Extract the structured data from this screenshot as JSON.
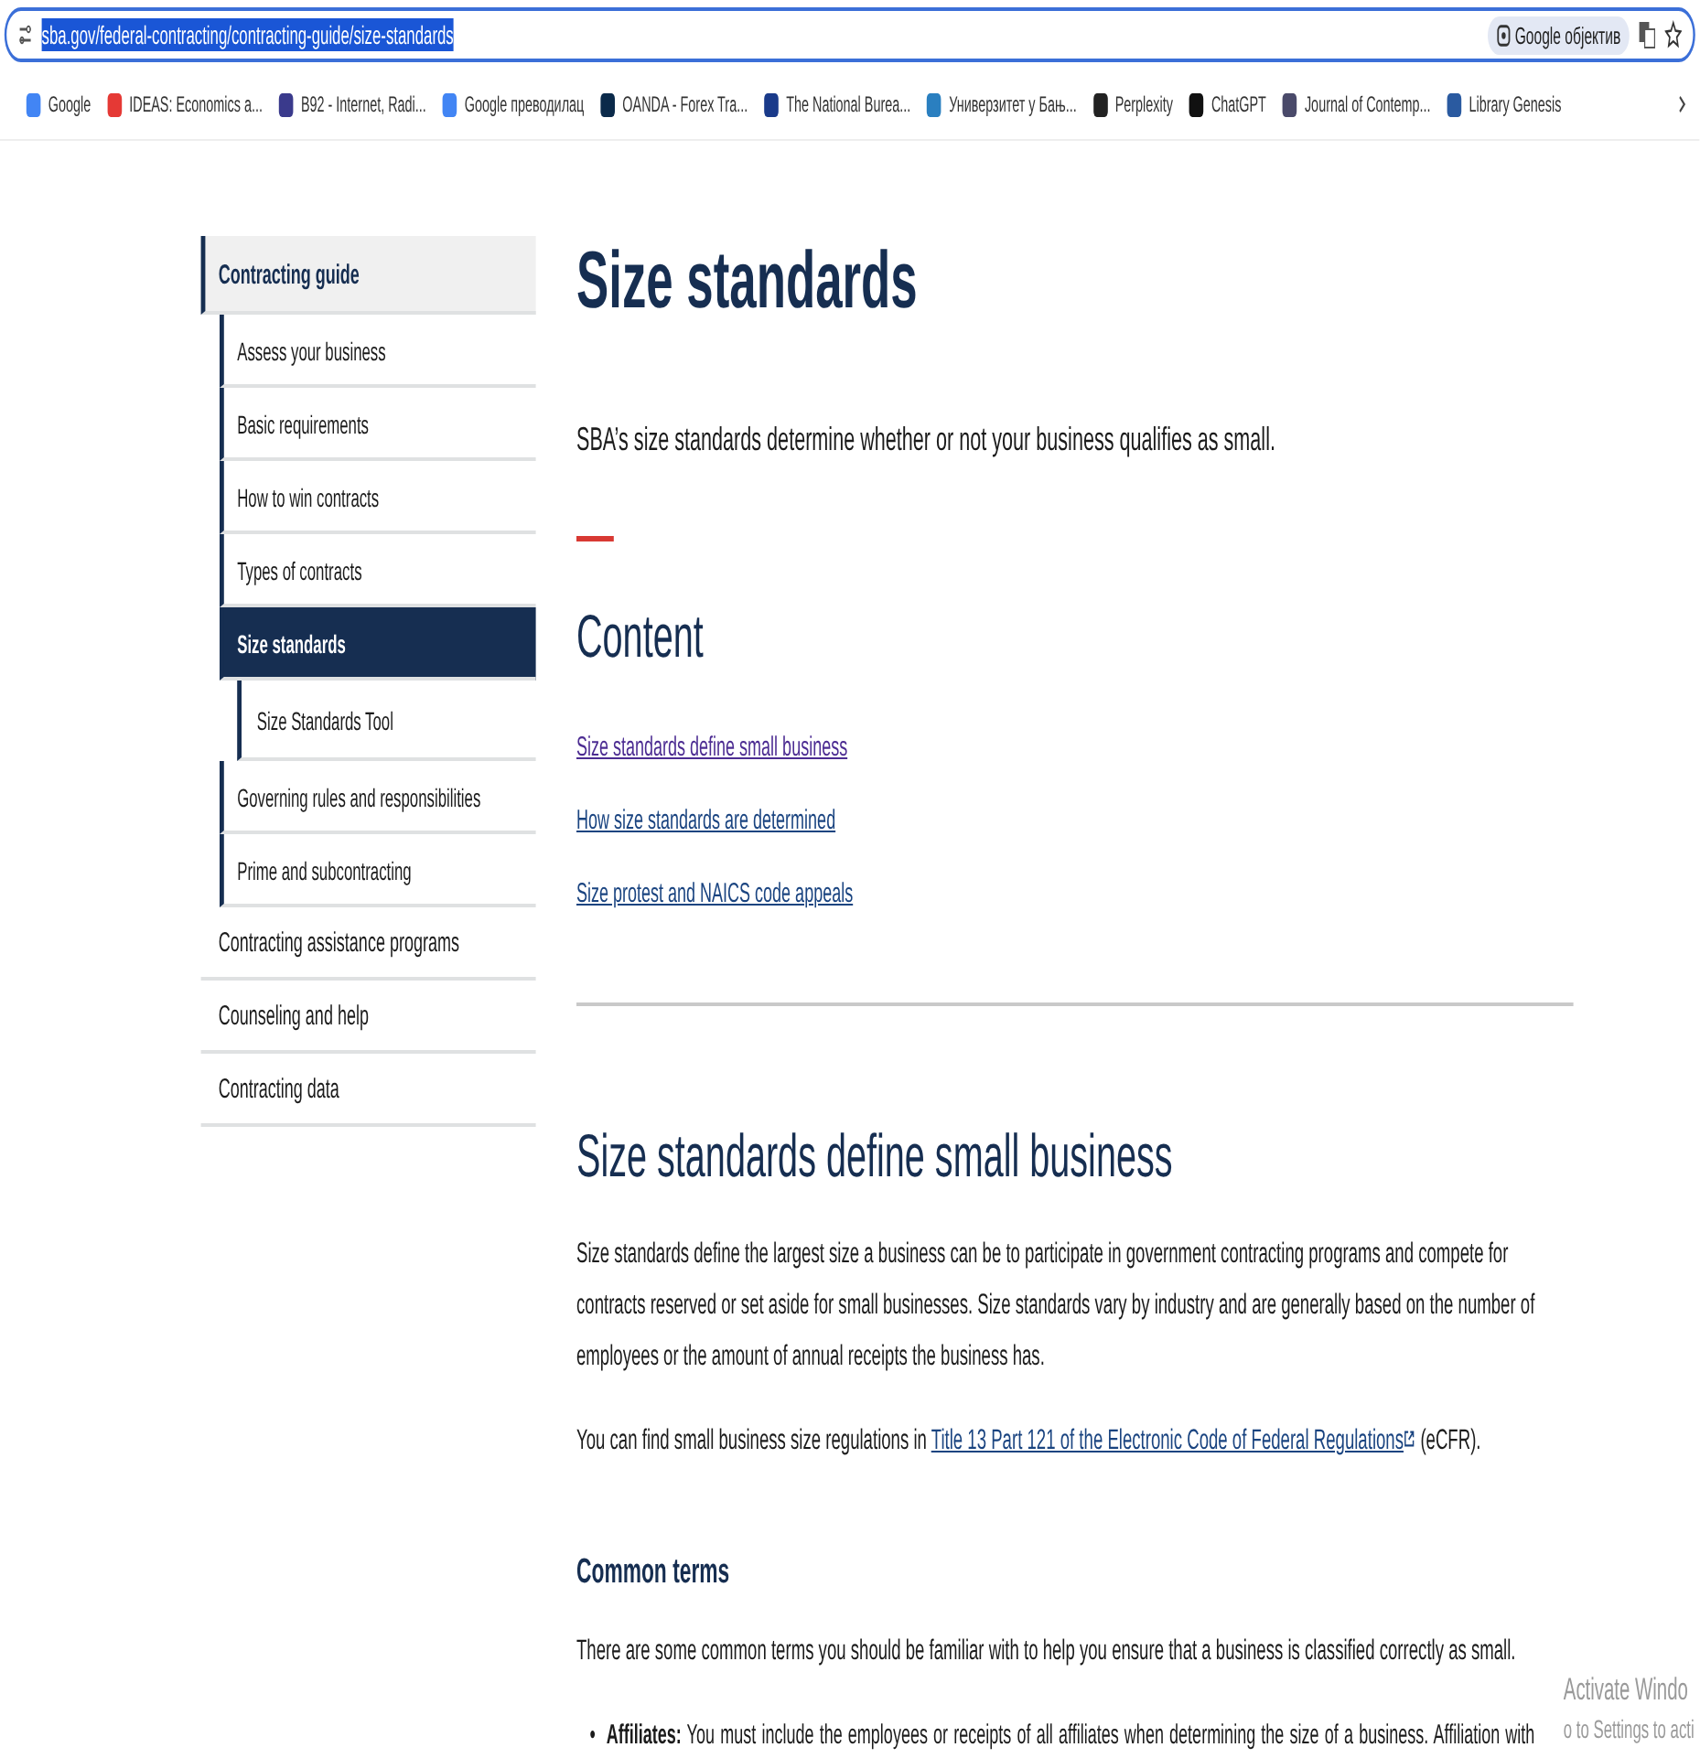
{
  "browser": {
    "url": "sba.gov/federal-contracting/contracting-guide/size-standards",
    "lens_label": "Google објектив",
    "bookmarks": [
      {
        "label": "Google",
        "color": "#4285f4"
      },
      {
        "label": "IDEAS: Economics a...",
        "color": "#e53935"
      },
      {
        "label": "B92 - Internet, Radi...",
        "color": "#3a3a8c"
      },
      {
        "label": "Google преводилац",
        "color": "#4285f4"
      },
      {
        "label": "OANDA - Forex Tra...",
        "color": "#0b2a4a"
      },
      {
        "label": "The National Burea...",
        "color": "#1a3a8a"
      },
      {
        "label": "Универзитет у Бањ...",
        "color": "#2a7fc0"
      },
      {
        "label": "Perplexity",
        "color": "#222222"
      },
      {
        "label": "ChatGPT",
        "color": "#111111"
      },
      {
        "label": "Journal of Contemp...",
        "color": "#4a4a6a"
      },
      {
        "label": "Library Genesis",
        "color": "#2a5aa0"
      }
    ]
  },
  "sidebar": {
    "items": [
      {
        "label": "Contracting guide",
        "selected": false,
        "expanded": true,
        "children": [
          {
            "label": "Assess your business",
            "selected": false
          },
          {
            "label": "Basic requirements",
            "selected": false
          },
          {
            "label": "How to win contracts",
            "selected": false
          },
          {
            "label": "Types of contracts",
            "selected": false
          },
          {
            "label": "Size standards",
            "selected": true,
            "children": [
              {
                "label": "Size Standards Tool",
                "selected": false
              }
            ]
          },
          {
            "label": "Governing rules and responsibilities",
            "selected": false
          },
          {
            "label": "Prime and subcontracting",
            "selected": false
          }
        ]
      },
      {
        "label": "Contracting assistance programs",
        "selected": false,
        "expanded": false
      },
      {
        "label": "Counseling and help",
        "selected": false,
        "expanded": false
      },
      {
        "label": "Contracting data",
        "selected": false,
        "expanded": false
      }
    ]
  },
  "page": {
    "title": "Size standards",
    "lead": "SBA’s size standards determine whether or not your business qualifies as small.",
    "contents_heading": "Content",
    "contents_links": [
      {
        "label": "Size standards define small business",
        "visited": true
      },
      {
        "label": "How size standards are determined",
        "visited": false
      },
      {
        "label": "Size protest and NAICS code appeals",
        "visited": false
      }
    ],
    "section_heading": "Size standards define small business",
    "paragraph": "Size standards define the largest size a business can be to participate in government contracting programs and compete for contracts reserved or set aside for small businesses. Size standards vary by industry and are generally based on the number of employees or the amount of annual receipts the business has.",
    "regulations": {
      "before": "You can find small business size regulations in",
      "link": "Title 13 Part 121 of the Electronic Code of Federal Regulations",
      "after": "(eCFR)."
    },
    "subheading": "Common terms",
    "terms_intro": "There are some common terms you should be familiar with to help you ensure that a business is classified correctly as small.",
    "bullets": [
      {
        "marker": "•",
        "text": "**Affiliates:** You must include the employees or receipts of all affiliates when determining the size of a business. Affiliation with"
      }
    ]
  },
  "os_notice": {
    "title": "Activate Windo",
    "subtitle": "o to Settings to acti"
  }
}
